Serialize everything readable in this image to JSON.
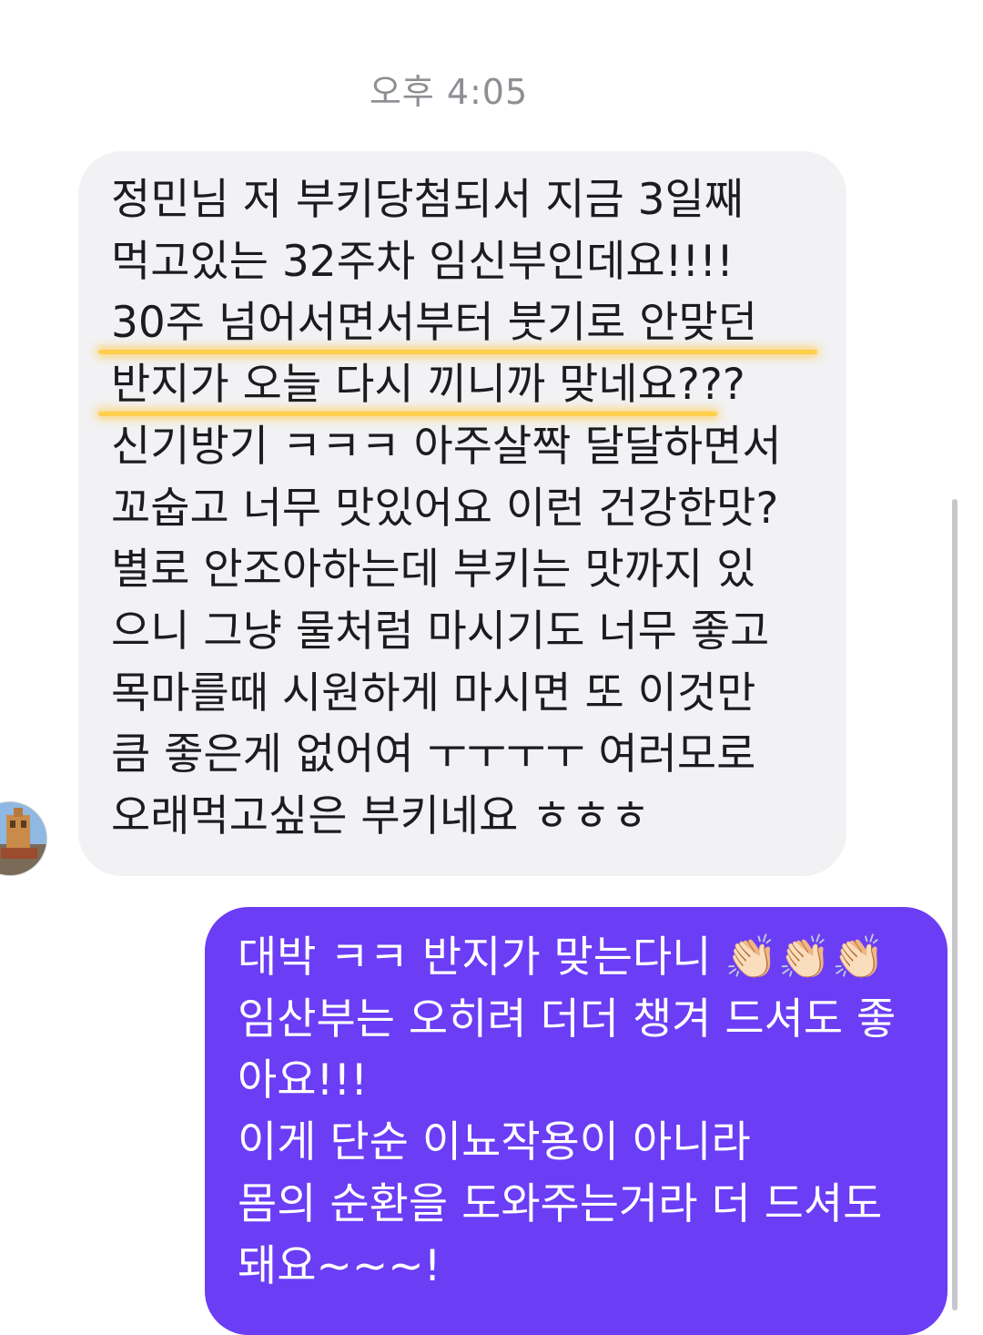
{
  "chat": {
    "timestamp": "오후 4:05",
    "incoming": {
      "lines": [
        "정민님 저 부키당첨되서 지금 3일째",
        "먹고있는 32주차 임신부인데요!!!!",
        "30주 넘어서면서부터 붓기로 안맞던",
        "반지가 오늘 다시 끼니까 맞네요???",
        "신기방기 ㅋㅋㅋ 아주살짝 달달하면서",
        "꼬숩고 너무 맛있어요 이런 건강한맛?",
        "별로 안조아하는데 부키는 맛까지 있",
        "으니 그냥 물처럼 마시기도 너무 좋고",
        "목마를때 시원하게 마시면 또 이것만",
        "큼 좋은게 없어여 ㅜㅜㅜㅜ 여러모로",
        "오래먹고싶은 부키네요 ㅎㅎㅎ"
      ]
    },
    "outgoing": {
      "lines": [
        "대박 ㅋㅋ 반지가 맞는다니 👏🏻👏🏻👏🏻",
        "임산부는 오히려 더더 챙겨 드셔도 좋",
        "아요!!!",
        "이게 단순 이뇨작용이 아니라",
        "몸의 순환을 도와주는거라 더 드셔도",
        "돼요~~~!"
      ]
    }
  },
  "colors": {
    "incoming_bubble": "#f2f2f4",
    "outgoing_bubble": "#6b3df5",
    "highlight": "#ffcf4d",
    "timestamp_text": "#8e8e93"
  }
}
